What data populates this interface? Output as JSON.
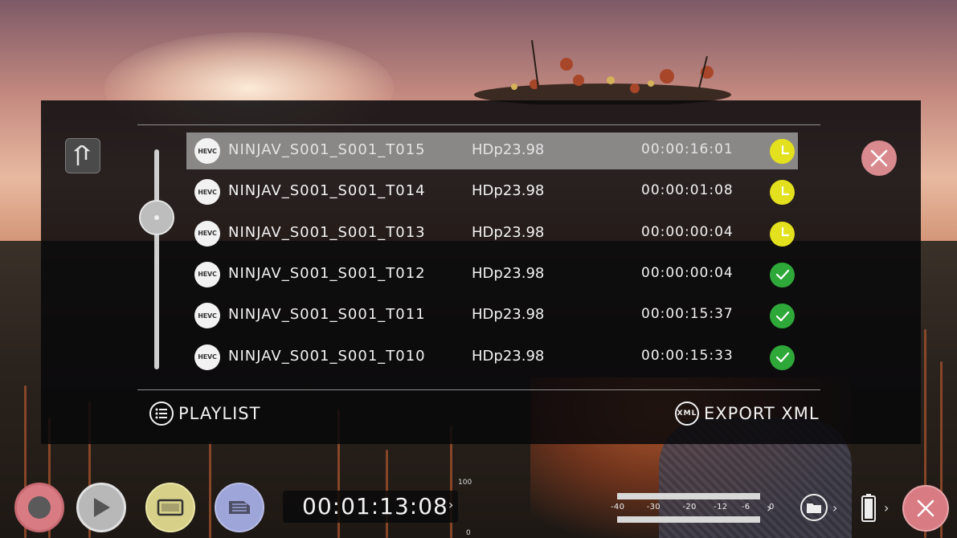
{
  "panel": {
    "rows": [
      {
        "codec": "HEVC",
        "name": "NINJAV_S001_S001_T015",
        "format": "HDp23.98",
        "duration": "00:00:16:01",
        "status": "pending",
        "selected": true
      },
      {
        "codec": "HEVC",
        "name": "NINJAV_S001_S001_T014",
        "format": "HDp23.98",
        "duration": "00:00:01:08",
        "status": "pending",
        "selected": false
      },
      {
        "codec": "HEVC",
        "name": "NINJAV_S001_S001_T013",
        "format": "HDp23.98",
        "duration": "00:00:00:04",
        "status": "pending",
        "selected": false
      },
      {
        "codec": "HEVC",
        "name": "NINJAV_S001_S001_T012",
        "format": "HDp23.98",
        "duration": "00:00:00:04",
        "status": "done",
        "selected": false
      },
      {
        "codec": "HEVC",
        "name": "NINJAV_S001_S001_T011",
        "format": "HDp23.98",
        "duration": "00:00:15:37",
        "status": "done",
        "selected": false
      },
      {
        "codec": "HEVC",
        "name": "NINJAV_S001_S001_T010",
        "format": "HDp23.98",
        "duration": "00:00:15:33",
        "status": "done",
        "selected": false
      }
    ],
    "playlist_label": "PLAYLIST",
    "export_label": "EXPORT XML",
    "export_icon_text": "XML"
  },
  "toolbar": {
    "timecode": "00:01:13:08",
    "scale_top": "100",
    "scale_bottom": "0",
    "meter_scale": [
      "-40",
      "-30",
      "-20",
      "-12",
      "-6",
      "0"
    ]
  },
  "colors": {
    "pending": "#e3e01d",
    "done": "#2fa83a",
    "close": "#d98a8e",
    "record": "#d97b82",
    "play": "#b8b8b8",
    "monitor": "#d7d089",
    "playlist_btn": "#9ea5d8"
  },
  "icons": [
    "up-arrow-icon",
    "close-icon",
    "hevc-icon",
    "clock-icon",
    "check-icon",
    "list-icon",
    "xml-icon",
    "record-icon",
    "play-icon",
    "monitor-icon",
    "stack-icon",
    "folder-icon",
    "battery-icon"
  ]
}
